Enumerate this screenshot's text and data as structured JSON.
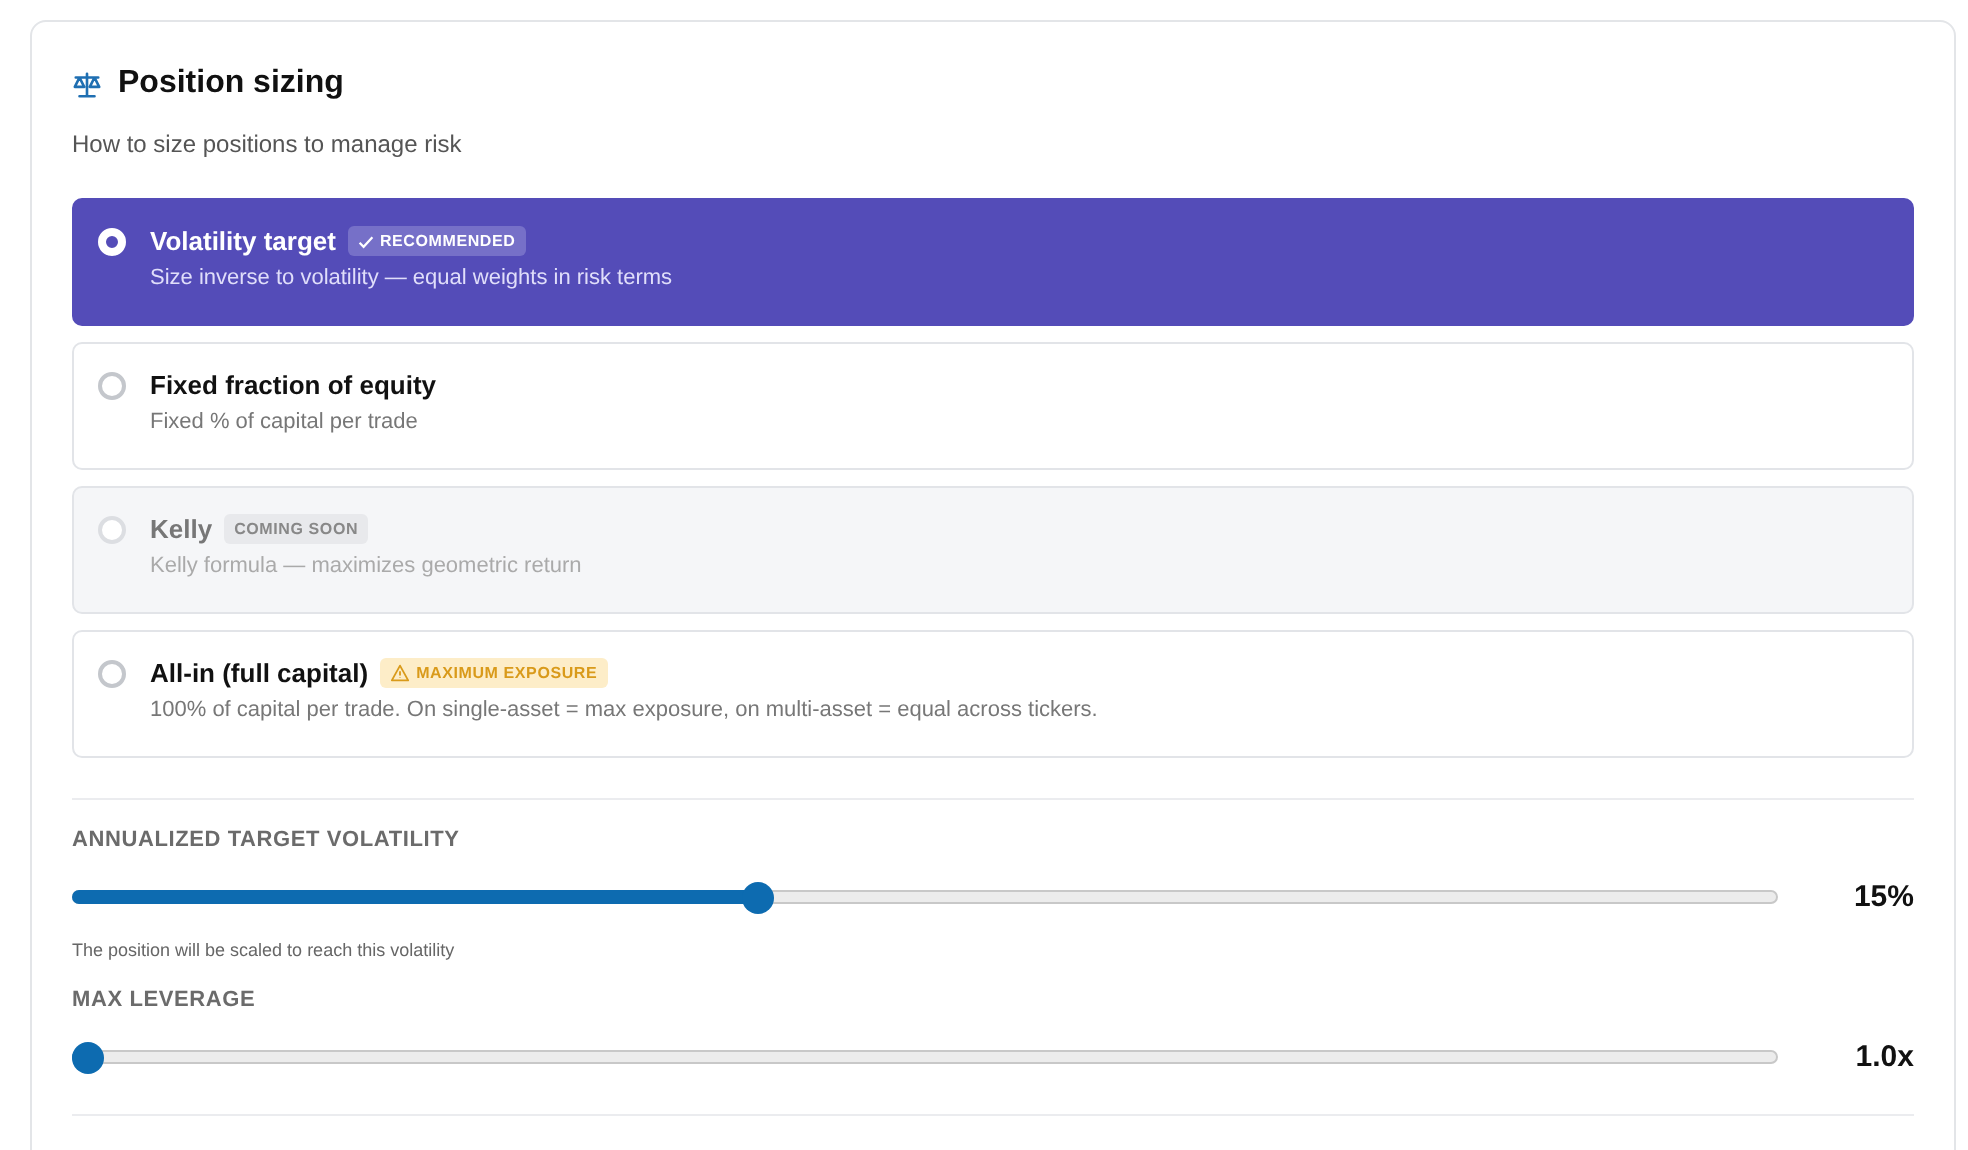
{
  "panel": {
    "title": "Position sizing",
    "subtitle": "How to size positions to manage risk"
  },
  "options": [
    {
      "label": "Volatility target",
      "description": "Size inverse to volatility — equal weights in risk terms",
      "selected": true,
      "disabled": false,
      "badge": {
        "kind": "recommended",
        "text": "RECOMMENDED"
      }
    },
    {
      "label": "Fixed fraction of equity",
      "description": "Fixed % of capital per trade",
      "selected": false,
      "disabled": false
    },
    {
      "label": "Kelly",
      "description": "Kelly formula — maximizes geometric return",
      "selected": false,
      "disabled": true,
      "badge": {
        "kind": "soon",
        "text": "COMING SOON"
      }
    },
    {
      "label": "All-in (full capital)",
      "description": "100% of capital per trade. On single-asset = max exposure, on multi-asset = equal across tickers.",
      "selected": false,
      "disabled": false,
      "badge": {
        "kind": "warning",
        "text": "MAXIMUM EXPOSURE"
      }
    }
  ],
  "sliders": [
    {
      "label": "ANNUALIZED TARGET VOLATILITY",
      "level": 0.4,
      "reading": "15%",
      "hint": "The position will be scaled to reach this volatility"
    },
    {
      "label": "MAX LEVERAGE",
      "level": 0,
      "reading": "1.0x"
    }
  ]
}
